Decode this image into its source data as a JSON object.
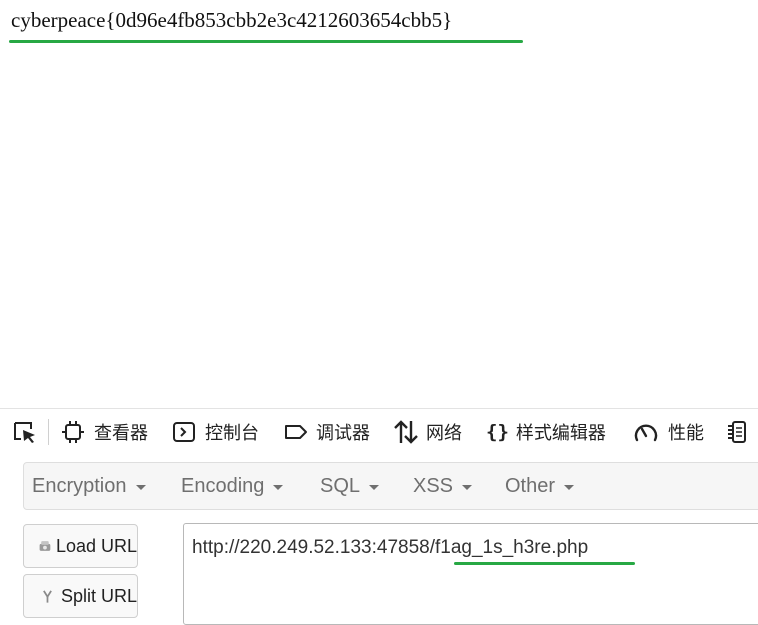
{
  "page": {
    "flag_text": "cyberpeace{0d96e4fb853cbb2e3c4212603654cbb5}",
    "highlight_color": "#27a844"
  },
  "devtools": {
    "tabs": [
      {
        "label": "",
        "icon": "pick-element-icon"
      },
      {
        "label": "查看器",
        "icon": "inspector-icon"
      },
      {
        "label": "控制台",
        "icon": "console-icon"
      },
      {
        "label": "调试器",
        "icon": "debugger-icon"
      },
      {
        "label": "网络",
        "icon": "network-icon"
      },
      {
        "label": "样式编辑器",
        "icon": "style-editor-icon"
      },
      {
        "label": "性能",
        "icon": "performance-icon"
      },
      {
        "label": "",
        "icon": "memory-icon"
      }
    ]
  },
  "hackbar": {
    "menu": [
      {
        "label": "Encryption"
      },
      {
        "label": "Encoding"
      },
      {
        "label": "SQL"
      },
      {
        "label": "XSS"
      },
      {
        "label": "Other"
      }
    ],
    "load_url_label": "Load URL",
    "split_url_label": "Split URL",
    "url_value": "http://220.249.52.133:47858/f1ag_1s_h3re.php"
  }
}
